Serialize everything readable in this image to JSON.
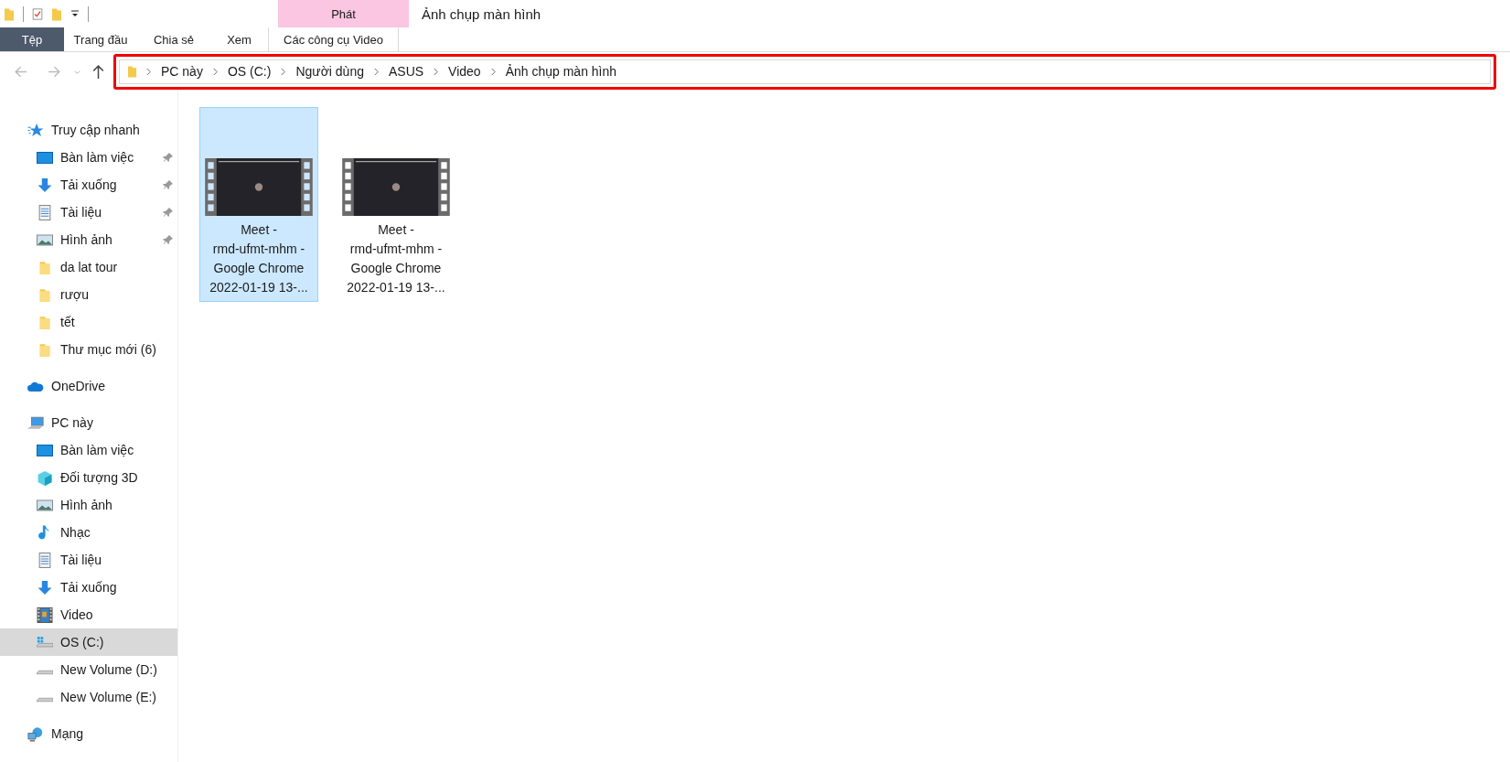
{
  "window": {
    "title": "Ảnh chụp màn hình"
  },
  "ribbon": {
    "context_header": "Phát",
    "tabs": [
      {
        "label": "Tệp",
        "kind": "file",
        "selected": false
      },
      {
        "label": "Trang đầu",
        "kind": "plain",
        "selected": false
      },
      {
        "label": "Chia sẻ",
        "kind": "plain",
        "selected": false
      },
      {
        "label": "Xem",
        "kind": "plain",
        "selected": false
      },
      {
        "label": "Các công cụ Video",
        "kind": "context",
        "selected": false
      }
    ]
  },
  "navigation": {
    "back_disabled": true,
    "forward_disabled": true
  },
  "address_bar": {
    "highlighted": true,
    "segments": [
      "PC này",
      "OS (C:)",
      "Người dùng",
      "ASUS",
      "Video",
      "Ảnh chụp màn hình"
    ]
  },
  "sidebar": {
    "sections": [
      {
        "label": "Truy cập nhanh",
        "kind": "star",
        "selected": false,
        "children": [
          {
            "label": "Bàn làm việc",
            "kind": "desktop",
            "pinned": true,
            "selected": false
          },
          {
            "label": "Tải xuống",
            "kind": "download",
            "pinned": true,
            "selected": false
          },
          {
            "label": "Tài liệu",
            "kind": "document",
            "pinned": true,
            "selected": false
          },
          {
            "label": "Hình ảnh",
            "kind": "picture",
            "pinned": true,
            "selected": false
          },
          {
            "label": "da lat tour",
            "kind": "folder",
            "pinned": false,
            "selected": false
          },
          {
            "label": "rượu",
            "kind": "folder",
            "pinned": false,
            "selected": false
          },
          {
            "label": "tết",
            "kind": "folder",
            "pinned": false,
            "selected": false
          },
          {
            "label": "Thư mục mới (6)",
            "kind": "folder",
            "pinned": false,
            "selected": false
          }
        ]
      },
      {
        "label": "OneDrive",
        "kind": "cloud",
        "selected": false
      },
      {
        "label": "PC này",
        "kind": "computer",
        "selected": false,
        "children": [
          {
            "label": "Bàn làm việc",
            "kind": "desktop",
            "pinned": false,
            "selected": false
          },
          {
            "label": "Đối tượng 3D",
            "kind": "cube",
            "pinned": false,
            "selected": false
          },
          {
            "label": "Hình ảnh",
            "kind": "picture",
            "pinned": false,
            "selected": false
          },
          {
            "label": "Nhạc",
            "kind": "music",
            "pinned": false,
            "selected": false
          },
          {
            "label": "Tài liệu",
            "kind": "document",
            "pinned": false,
            "selected": false
          },
          {
            "label": "Tải xuống",
            "kind": "download",
            "pinned": false,
            "selected": false
          },
          {
            "label": "Video",
            "kind": "video",
            "pinned": false,
            "selected": false
          },
          {
            "label": "OS (C:)",
            "kind": "windrive",
            "pinned": false,
            "selected": true
          },
          {
            "label": "New Volume (D:)",
            "kind": "drive",
            "pinned": false,
            "selected": false
          },
          {
            "label": "New Volume (E:)",
            "kind": "drive",
            "pinned": false,
            "selected": false
          }
        ]
      },
      {
        "label": "Mạng",
        "kind": "network",
        "selected": false
      }
    ]
  },
  "files": [
    {
      "name": "Meet -\nrmd-ufmt-mhm -\nGoogle Chrome\n2022-01-19 13-...",
      "selected": true
    },
    {
      "name": "Meet -\nrmd-ufmt-mhm -\nGoogle Chrome\n2022-01-19 13-...",
      "selected": false
    }
  ]
}
